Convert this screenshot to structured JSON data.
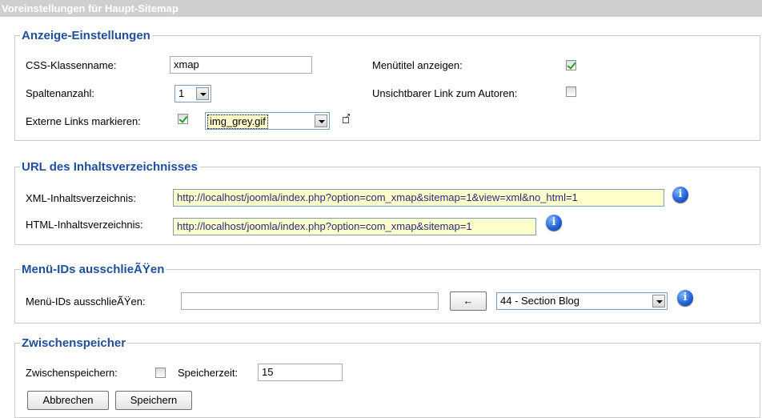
{
  "title": "Voreinstellungen für Haupt-Sitemap",
  "display": {
    "legend": "Anzeige-Einstellungen",
    "css_label": "CSS-Klassenname:",
    "css_value": "xmap",
    "columns_label": "Spaltenanzahl:",
    "columns_value": "1",
    "external_label": "Externe Links markieren:",
    "external_checked": true,
    "external_image": "img_grey.gif",
    "menutitle_label": "Menütitel anzeigen:",
    "menutitle_checked": true,
    "author_label": "Unsichtbarer Link zum Autoren:",
    "author_checked": false
  },
  "url": {
    "legend": "URL des Inhaltsverzeichnisses",
    "xml_label": "XML-Inhaltsverzeichnis:",
    "xml_value": "http://localhost/joomla/index.php?option=com_xmap&sitemap=1&view=xml&no_html=1",
    "html_label": "HTML-Inhaltsverzeichnis:",
    "html_value": "http://localhost/joomla/index.php?option=com_xmap&sitemap=1"
  },
  "exclude": {
    "legend": "Menü-IDs ausschlieÃŸen",
    "label": "Menü-IDs ausschlieÃŸen:",
    "value": "",
    "arrow_label": "←",
    "select_value": "44 - Section Blog"
  },
  "cache": {
    "legend": "Zwischenspeicher",
    "cache_label": "Zwischenspeichern:",
    "cache_checked": false,
    "time_label": "Speicherzeit:",
    "time_value": "15"
  },
  "buttons": {
    "cancel": "Abbrechen",
    "save": "Speichern"
  },
  "icons": {
    "info": "info-icon",
    "external": "external-link-icon"
  }
}
